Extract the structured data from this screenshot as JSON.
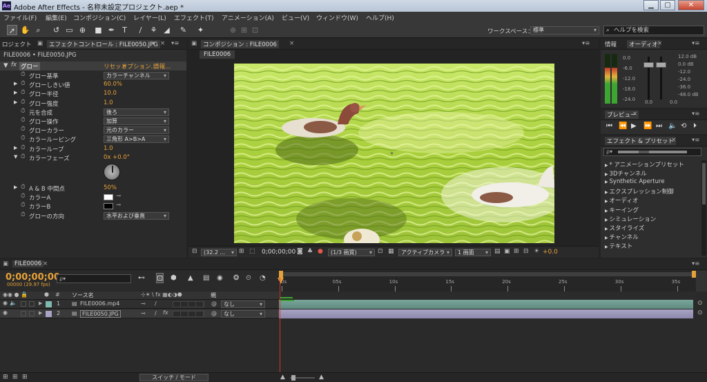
{
  "titlebar": {
    "app_icon": "Ae",
    "title": "Adobe After Effects - 名称未設定プロジェクト.aep *",
    "min": "▁",
    "max": "▢",
    "close": "✕"
  },
  "menus": [
    "ファイル(F)",
    "編集(E)",
    "コンポジション(C)",
    "レイヤー(L)",
    "エフェクト(T)",
    "アニメーション(A)",
    "ビュー(V)",
    "ウィンドウ(W)",
    "ヘルプ(H)"
  ],
  "toolbar": {
    "workspace_label": "ワークスペース：",
    "workspace_value": "標準",
    "help_search_placeholder": "ヘルプを検索"
  },
  "left_panel": {
    "tab_project": "ロジェクト",
    "tab_effect_controls": "エフェクトコントロール : FILE0050.JPG",
    "subtitle": "FILE0006 • FILE0050.JPG",
    "effect_name": "グロー",
    "effect_links": [
      "リセット",
      "オプション...",
      "情報..."
    ],
    "properties": [
      {
        "label": "グロー基準",
        "type": "dropdown",
        "value": "カラーチャンネル"
      },
      {
        "label": "グローしきい値",
        "type": "value",
        "value": "60.0%"
      },
      {
        "label": "グロー半径",
        "type": "value",
        "value": "10.0"
      },
      {
        "label": "グロー強度",
        "type": "value",
        "value": "1.0"
      },
      {
        "label": "元を合成",
        "type": "dropdown",
        "value": "後ろ"
      },
      {
        "label": "グロー操作",
        "type": "dropdown",
        "value": "加算"
      },
      {
        "label": "グローカラー",
        "type": "dropdown",
        "value": "元のカラー"
      },
      {
        "label": "カラールーピング",
        "type": "dropdown",
        "value": "三角形 A>B>A"
      },
      {
        "label": "カラーループ",
        "type": "value",
        "value": "1.0"
      },
      {
        "label": "カラーフェーズ",
        "type": "value",
        "value": "0x +0.0°"
      },
      {
        "label": "A & B 中間点",
        "type": "value",
        "value": "50%"
      },
      {
        "label": "カラーA",
        "type": "color",
        "value": "#ffffff"
      },
      {
        "label": "カラーB",
        "type": "color",
        "value": "#000000"
      },
      {
        "label": "グローの方向",
        "type": "dropdown",
        "value": "水平および垂直"
      }
    ]
  },
  "comp_panel": {
    "tab_label": "コンポジション : FILE0006",
    "sub_tab": "FILE0006",
    "zoom": "(32.2 ...",
    "timecode": "0;00;00;00",
    "resolution": "(1/3 画質)",
    "camera": "アクティブカメラ",
    "views": "1 画面",
    "exposure": "+0.0"
  },
  "info_panel": {
    "tab_info": "情報",
    "tab_audio": "オーディオ",
    "left_scale": [
      "0.0",
      "-6.0",
      "-12.0",
      "-18.0",
      "-24.0"
    ],
    "right_scale": [
      "12.0 dB",
      "0.0 dB",
      "-12.0",
      "-24.0",
      "-36.0",
      "-48.0 dB"
    ],
    "bottom": [
      "0.0",
      "0.0"
    ],
    "meter_fill": [
      0.72,
      0.72
    ]
  },
  "preview_panel": {
    "tab": "プレビュー"
  },
  "effects_panel": {
    "tab": "エフェクト & プリセット",
    "search_placeholder": "ρ▾",
    "items": [
      "* アニメーションプリセット",
      "3Dチャンネル",
      "Synthetic Aperture",
      "エクスプレッション制御",
      "オーディオ",
      "キーイング",
      "シミュレーション",
      "スタイライズ",
      "チャンネル",
      "テキスト"
    ]
  },
  "timeline": {
    "tab": "FILE0006",
    "timecode": "0;00;00;00",
    "fps": "00000 (29.97 fps)",
    "search_placeholder": "ρ▾",
    "col_source": "ソース名",
    "col_parent": "親",
    "layers": [
      {
        "num": "1",
        "name": "FILE0006.mp4",
        "parent": "なし",
        "color": "#7fb9b0"
      },
      {
        "num": "2",
        "name": "FILE0050.JPG",
        "parent": "なし",
        "color": "#a9a3c8"
      }
    ],
    "ruler": [
      "0s",
      "05s",
      "10s",
      "15s",
      "20s",
      "25s",
      "30s",
      "35s"
    ],
    "switch_mode": "スイッチ / モード"
  }
}
